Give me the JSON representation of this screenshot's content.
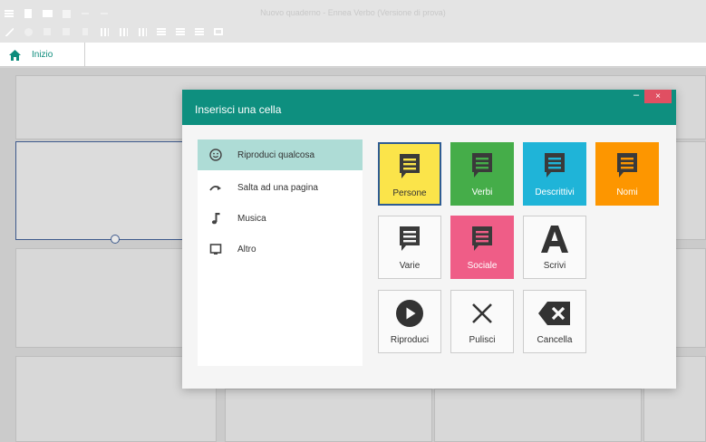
{
  "window": {
    "title": "Nuovo quaderno - Ennea Verbo (Versione di prova)"
  },
  "ribbon": {
    "home_label": "Inizio"
  },
  "dialog": {
    "title": "Inserisci una cella",
    "minimize_label": "–",
    "close_label": "×",
    "categories": [
      {
        "label": "Riproduci qualcosa",
        "icon": "smiley-icon",
        "selected": true
      },
      {
        "label": "Salta ad una pagina",
        "icon": "jump-arrow-icon",
        "selected": false
      },
      {
        "label": "Musica",
        "icon": "music-note-icon",
        "selected": false
      },
      {
        "label": "Altro",
        "icon": "tablet-icon",
        "selected": false
      }
    ],
    "tiles": [
      {
        "label": "Persone",
        "icon": "speech-bubble-icon",
        "bg": "#fbe44a",
        "fg": "#3a3a3a",
        "selected": true
      },
      {
        "label": "Verbi",
        "icon": "speech-bubble-icon",
        "bg": "#45ad49",
        "fg": "#3a3a3a",
        "selected": false
      },
      {
        "label": "Descrittivi",
        "icon": "speech-bubble-icon",
        "bg": "#1fb4d8",
        "fg": "#3a3a3a",
        "selected": false
      },
      {
        "label": "Nomi",
        "icon": "speech-bubble-icon",
        "bg": "#fd9600",
        "fg": "#3a3a3a",
        "selected": false
      },
      {
        "label": "Varie",
        "icon": "speech-bubble-icon",
        "bg": "#fafafa",
        "fg": "#333333",
        "selected": false
      },
      {
        "label": "Sociale",
        "icon": "speech-bubble-icon",
        "bg": "#ef5d87",
        "fg": "#3a3a3a",
        "selected": false
      },
      {
        "label": "Scrivi",
        "icon": "letter-a-icon",
        "bg": "#fafafa",
        "fg": "#333333",
        "selected": false
      },
      {
        "label": "Riproduci",
        "icon": "play-icon",
        "bg": "#fafafa",
        "fg": "#333333",
        "selected": false
      },
      {
        "label": "Pulisci",
        "icon": "clear-x-icon",
        "bg": "#fafafa",
        "fg": "#333333",
        "selected": false
      },
      {
        "label": "Cancella",
        "icon": "backspace-icon",
        "bg": "#fafafa",
        "fg": "#333333",
        "selected": false
      }
    ]
  },
  "colors": {
    "accent": "#0e8f7f",
    "close": "#e04f62",
    "selection_border": "#2f5c93",
    "category_selected": "#aedcd6"
  }
}
